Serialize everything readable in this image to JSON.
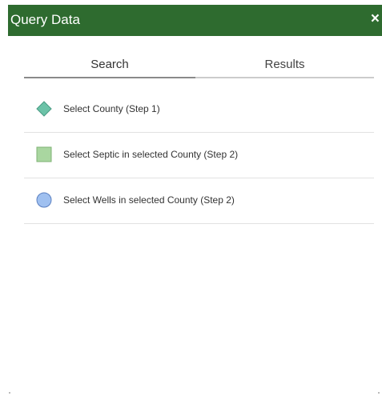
{
  "panel": {
    "title": "Query Data",
    "close_label": "×"
  },
  "tabs": [
    {
      "label": "Search",
      "active": true
    },
    {
      "label": "Results",
      "active": false
    }
  ],
  "items": [
    {
      "label": "Select County (Step 1)",
      "icon": "diamond-icon",
      "color": "#6cc3a8"
    },
    {
      "label": "Select Septic in selected County (Step 2)",
      "icon": "square-icon",
      "color": "#a9d6a0"
    },
    {
      "label": "Select Wells in selected County (Step 2)",
      "icon": "circle-icon",
      "color": "#9fc0f0"
    }
  ],
  "colors": {
    "header": "#2e6b2f",
    "header_text": "#ffffff"
  }
}
